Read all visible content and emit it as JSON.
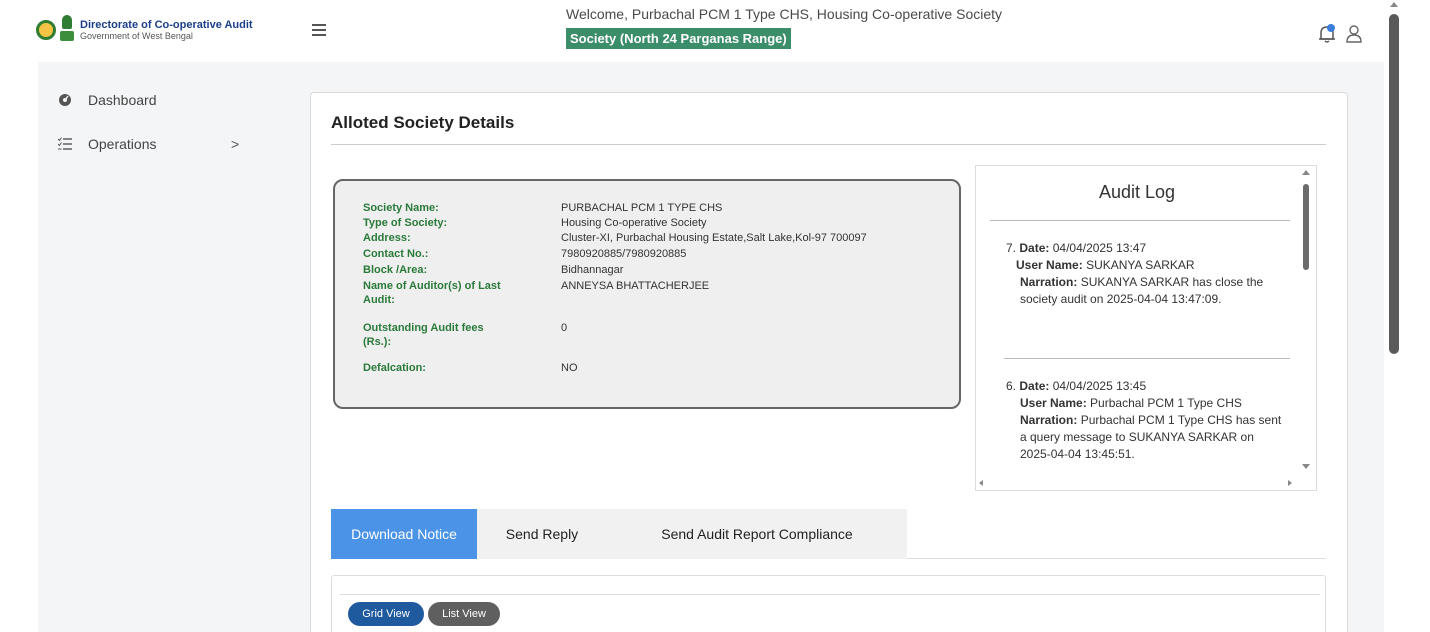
{
  "brand": {
    "title": "Directorate of Co-operative Audit",
    "subtitle": "Government of West Bengal"
  },
  "header": {
    "welcome": "Welcome,  Purbachal PCM 1 Type CHS,  Housing Co-operative Society",
    "range": "Society (North 24 Parganas Range)"
  },
  "sidebar": {
    "items": [
      {
        "label": "Dashboard",
        "icon": "dashboard-icon"
      },
      {
        "label": "Operations",
        "icon": "list-icon",
        "chevron": ">"
      }
    ]
  },
  "main": {
    "title": "Alloted Society Details",
    "details": [
      {
        "label": "Society Name:",
        "value": "PURBACHAL PCM 1 TYPE CHS"
      },
      {
        "label": "Type of Society:",
        "value": "Housing Co-operative Society"
      },
      {
        "label": "Address:",
        "value": "Cluster-XI, Purbachal Housing Estate,Salt Lake,Kol-97 700097"
      },
      {
        "label": "Contact No.:",
        "value": "7980920885/7980920885"
      },
      {
        "label": "Block /Area:",
        "value": "Bidhannagar"
      },
      {
        "label": "Name of Auditor(s) of Last Audit:",
        "value": "ANNEYSA BHATTACHERJEE"
      },
      {
        "label": "Outstanding Audit fees (Rs.):",
        "value": "0"
      },
      {
        "label": "Defalcation:",
        "value": "NO"
      }
    ],
    "audit_log": {
      "title": "Audit Log",
      "entries": [
        {
          "num": "7.",
          "date_label": "Date:",
          "date": "04/04/2025 13:47",
          "user_label": "User Name:",
          "user": "SUKANYA SARKAR",
          "narration_label": "Narration:",
          "narration": "SUKANYA SARKAR has close the society audit on 2025-04-04 13:47:09."
        },
        {
          "num": "6.",
          "date_label": "Date:",
          "date": "04/04/2025 13:45",
          "user_label": "User Name:",
          "user": "Purbachal PCM 1 Type CHS",
          "narration_label": "Narration:",
          "narration": "Purbachal PCM 1 Type CHS has sent a query message to SUKANYA SARKAR on 2025-04-04 13:45:51."
        }
      ]
    },
    "tabs": [
      {
        "label": "Download Notice",
        "active": true
      },
      {
        "label": "Send Reply",
        "active": false
      },
      {
        "label": "Send Audit Report Compliance",
        "active": false
      }
    ],
    "views": [
      {
        "label": "Grid View",
        "color": "#1f5a9e"
      },
      {
        "label": "List View",
        "color": "#5f5f5f"
      }
    ]
  },
  "colors": {
    "accent": "#4b93e7",
    "label_green": "#2a7a3a",
    "badge_green": "#3c8d6a"
  }
}
